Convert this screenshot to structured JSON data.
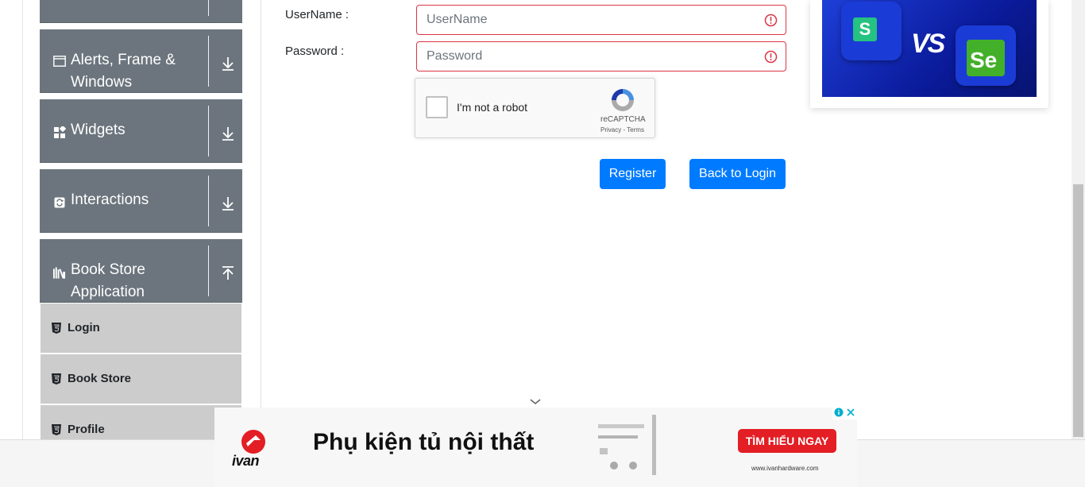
{
  "sidebar": {
    "groups": [
      {
        "label": "Alerts, Frame & Windows",
        "icon": "window-icon",
        "expanded": false
      },
      {
        "label": "Widgets",
        "icon": "widgets-icon",
        "expanded": false
      },
      {
        "label": "Interactions",
        "icon": "interactions-icon",
        "expanded": false
      },
      {
        "label": "Book Store Application",
        "icon": "books-icon",
        "expanded": true
      }
    ],
    "book_store_items": [
      {
        "label": "Login"
      },
      {
        "label": "Book Store"
      },
      {
        "label": "Profile"
      }
    ]
  },
  "form": {
    "username_label": "UserName :",
    "username_placeholder": "UserName",
    "username_value": "",
    "password_label": "Password :",
    "password_placeholder": "Password",
    "password_value": "",
    "error_color": "#dc3545"
  },
  "captcha": {
    "text": "I'm not a robot",
    "brand": "reCAPTCHA",
    "links": "Privacy - Terms",
    "checked": false
  },
  "buttons": {
    "register": "Register",
    "back_to_login": "Back to Login",
    "color": "#007bff"
  },
  "right_ad": {
    "vs_text": "VS",
    "left_logo": "S",
    "right_logo": "Se"
  },
  "bottom_ad": {
    "brand": "ivan",
    "headline": "Phụ kiện tủ nội thất",
    "cta": "TÌM HIỂU NGAY",
    "url": "www.ivanhardware.com"
  },
  "colors": {
    "sidebar_group_bg": "#6c757d",
    "sidebar_item_bg": "#cccccc",
    "cta_red": "#e31e24"
  }
}
